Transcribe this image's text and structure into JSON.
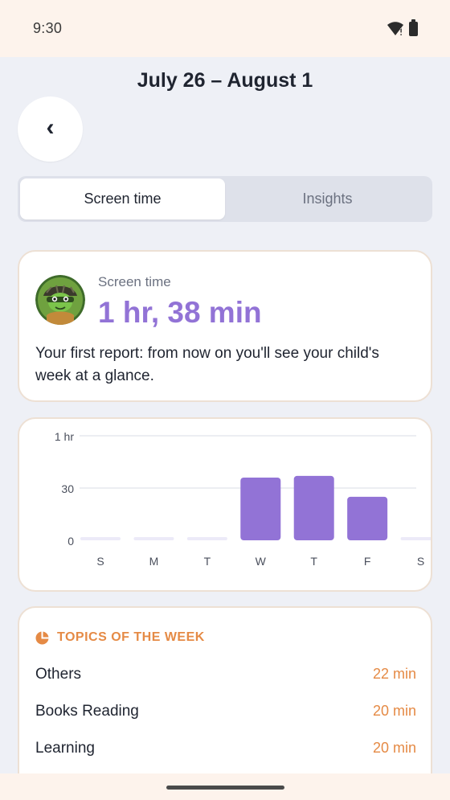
{
  "status_bar": {
    "time": "9:30"
  },
  "header": {
    "title": "July 26 – August 1"
  },
  "tabs": [
    {
      "label": "Screen time",
      "active": true
    },
    {
      "label": "Insights",
      "active": false
    }
  ],
  "summary": {
    "label": "Screen time",
    "value": "1 hr, 38 min",
    "description": "Your first report: from now on you'll see your child's week at a glance."
  },
  "chart_data": {
    "type": "bar",
    "categories": [
      "S",
      "M",
      "T",
      "W",
      "T",
      "F",
      "S"
    ],
    "values": [
      0,
      0,
      0,
      36,
      37,
      25,
      0
    ],
    "y_tick_labels": [
      "1 hr",
      "30",
      "0"
    ],
    "ylim": [
      0,
      60
    ],
    "grid": true,
    "bar_color": "#9273D6"
  },
  "topics": {
    "header": "TOPICS OF THE WEEK",
    "items": [
      {
        "name": "Others",
        "value": "22 min"
      },
      {
        "name": "Books Reading",
        "value": "20 min"
      },
      {
        "name": "Learning",
        "value": "20 min"
      }
    ]
  },
  "colors": {
    "accent_purple": "#9273D6",
    "accent_orange": "#E58A45",
    "background": "#EEF0F6"
  }
}
